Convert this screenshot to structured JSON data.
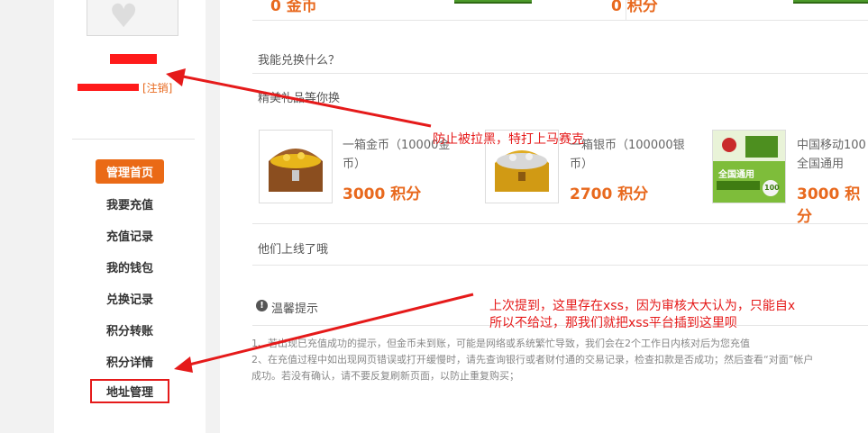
{
  "sidebar": {
    "logout_label": "[注销]",
    "nav": [
      {
        "label": "管理首页",
        "active": true
      },
      {
        "label": "我要充值"
      },
      {
        "label": "充值记录"
      },
      {
        "label": "我的钱包"
      },
      {
        "label": "兑换记录"
      },
      {
        "label": "积分转账"
      },
      {
        "label": "积分详情"
      },
      {
        "label": "地址管理",
        "highlighted": true
      }
    ]
  },
  "balance": {
    "gold": "0 金币",
    "points": "0 积分"
  },
  "sections": {
    "exchange_question": "我能兑换什么？",
    "featured_gifts": "精美礼品等你换",
    "they_are_online": "他们上线了哦",
    "tips_title": "温馨提示"
  },
  "gifts": [
    {
      "name_line1": "一箱金币（10000金",
      "name_line2": "币）",
      "price": "3000 积分",
      "image": "gold-chest"
    },
    {
      "name_line1": "一箱银币（100000银",
      "name_line2": "币）",
      "price": "2700 积分",
      "image": "silver-chest"
    },
    {
      "name_line1": "中国移动100",
      "name_line2": "全国通用",
      "price": "3000 积分",
      "image": "mobile-card",
      "card_text": "全国通用",
      "card_value": "100"
    }
  ],
  "tips": {
    "line1": "1、若出现已充值成功的提示，但金币未到账，可能是网络或系统繁忙导致，我们会在2个工作日内核对后为您充值",
    "line2": "2、在充值过程中如出现网页错误或打开缓慢时，请先查询银行或者财付通的交易记录，检查扣款是否成功；然后查看“对面”帐户",
    "line3": "成功。若没有确认，请不要反复刷新页面，以防止重复购买；"
  },
  "annotations": {
    "top": "防止被拉黑，特打上马赛克",
    "bottom_line1": "上次提到，这里存在xss，因为审核大大认为，只能自x",
    "bottom_line2": "所以不给过，那我们就把xss平台插到这里呗"
  },
  "colors": {
    "accent": "#ea6a16",
    "annotation_red": "#e51a1a",
    "price": "#e8691e"
  }
}
